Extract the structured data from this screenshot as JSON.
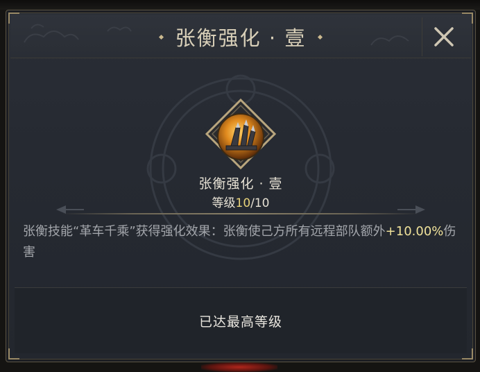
{
  "window": {
    "title": "张衡强化 · 壹",
    "close_icon": "close-x-icon"
  },
  "skill": {
    "icon": "chariot-skill-icon",
    "name": "张衡强化 · 壹",
    "level_prefix": "等级",
    "level_current": "10",
    "level_sep_max": "/10"
  },
  "description": {
    "before": "张衡技能“革车千乘”获得强化效果：张衡使己方所有远程部队额外",
    "value": "+10.00%",
    "after": "伤害"
  },
  "footer": {
    "status": "已达最高等级"
  },
  "colors": {
    "accent_gold": "#e8d37a",
    "highlight": "#f0e29a",
    "panel_bg": "#262a32",
    "text_main": "#e6e1d4",
    "text_desc": "#a3a6ab"
  }
}
